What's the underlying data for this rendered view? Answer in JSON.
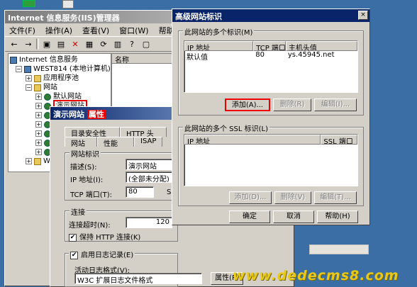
{
  "iis": {
    "title": "Internet 信息服务(IIS)管理器",
    "menu": [
      "文件(F)",
      "操作(A)",
      "查看(V)",
      "窗口(W)",
      "帮助(H)"
    ],
    "tree": [
      {
        "label": "Internet 信息服务",
        "indent": 0
      },
      {
        "label": "WEST814 (本地计算机)",
        "indent": 1
      },
      {
        "label": "应用程序池",
        "indent": 2
      },
      {
        "label": "网站",
        "indent": 2
      },
      {
        "label": "默认网站",
        "indent": 3
      },
      {
        "label": "演示网站",
        "indent": 3
      }
    ],
    "column_name": "名称",
    "tree_extra": "We"
  },
  "props": {
    "title": "演示网站",
    "title_hl": "属性",
    "tabs_row1": [
      "目录安全性",
      "HTTP 头"
    ],
    "tabs_row2": [
      "网站",
      "性能",
      "ISAP"
    ],
    "group_site_id": "网站标识",
    "desc_label": "描述(S):",
    "desc_value": "演示网站",
    "ip_label": "IP 地址(I):",
    "ip_value": "(全部未分配)",
    "tcp_label": "TCP 端口(T):",
    "tcp_value": "80",
    "tcp_right": "SS",
    "group_conn": "连接",
    "timeout_label": "连接超时(N):",
    "timeout_value": "120",
    "keepalive_label": "保持 HTTP 连接(K)",
    "logging_label": "启用日志记录(E)",
    "log_format_label": "活动日志格式(V):",
    "log_format_value": "W3C 扩展日志文件格式",
    "props_button": "属性(P)"
  },
  "adv": {
    "title": "高级网站标识",
    "close": "×",
    "group1_label": "此网站的多个标识(M)",
    "headers1": [
      "IP 地址",
      "TCP 端口",
      "主机头值"
    ],
    "rows1": [
      [
        "默认值",
        "80",
        "ys.45945.net"
      ]
    ],
    "add_button": "添加(A)...",
    "remove_button": "删除(R)",
    "edit_button": "编辑(I)...",
    "group2_label": "此网站的多个 SSL 标识(L)",
    "headers2": [
      "IP 地址",
      "SSL 端口"
    ],
    "add2_button": "添加(D)...",
    "remove2_button": "删除(V)",
    "edit2_button": "编辑(T)...",
    "ok_button": "确定",
    "cancel_button": "取消",
    "help_button": "帮助(H)"
  },
  "watermark": "www.dedecms8.com"
}
